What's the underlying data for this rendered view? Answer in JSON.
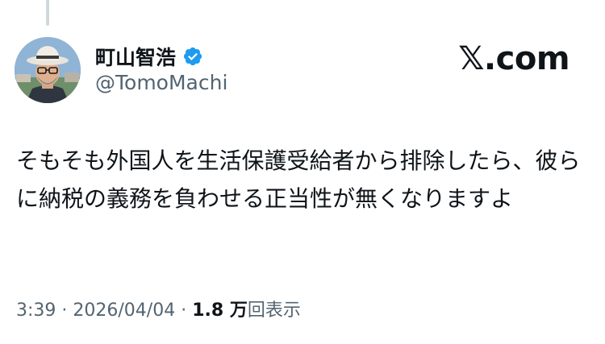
{
  "author": {
    "display_name": "町山智浩",
    "handle": "@TomoMachi",
    "verified_icon": "verified-badge-icon",
    "verified_color": "#1d9bf0"
  },
  "brand": {
    "label": "𝕏.com"
  },
  "tweet": {
    "text": "そもそも外国人を生活保護受給者から排除したら、彼らに納税の義務を負わせる正当性が無くなりますよ"
  },
  "meta": {
    "time": "3:39",
    "separator": " · ",
    "date": "2026/04/04",
    "views_count": "1.8 万",
    "views_label": "回表示"
  },
  "colors": {
    "text_primary": "#0f1419",
    "text_secondary": "#536471",
    "thread_line": "#cfd9de"
  }
}
